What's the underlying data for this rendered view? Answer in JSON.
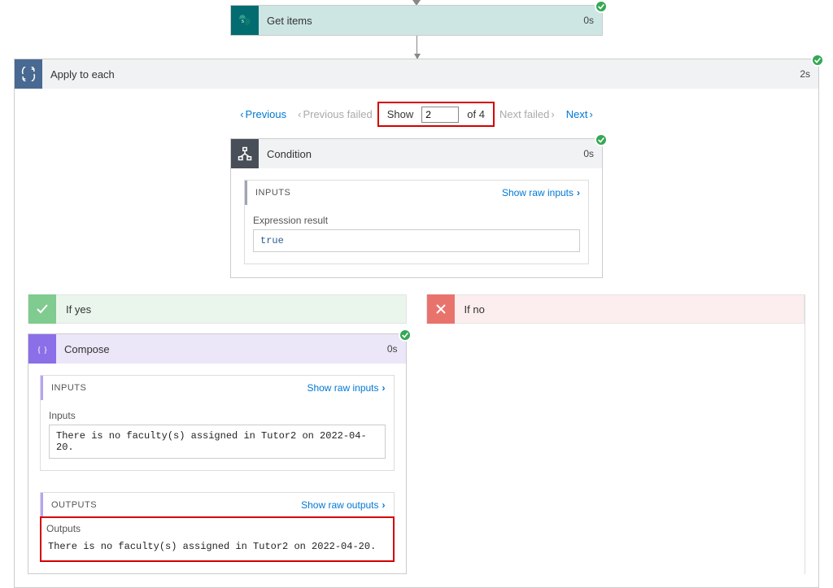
{
  "getItems": {
    "title": "Get items",
    "duration": "0s"
  },
  "applyToEach": {
    "title": "Apply to each",
    "duration": "2s"
  },
  "pager": {
    "previous": "Previous",
    "previousFailed": "Previous failed",
    "showLabel": "Show",
    "current": "2",
    "ofText": "of 4",
    "nextFailed": "Next failed",
    "next": "Next"
  },
  "condition": {
    "title": "Condition",
    "duration": "0s",
    "inputsLabel": "INPUTS",
    "showRawInputs": "Show raw inputs",
    "exprLabel": "Expression result",
    "exprValue": "true"
  },
  "branches": {
    "yes": "If yes",
    "no": "If no"
  },
  "compose": {
    "title": "Compose",
    "duration": "0s",
    "inputsLabel": "INPUTS",
    "showRawInputs": "Show raw inputs",
    "inputsField": "Inputs",
    "inputsValue": "There is no faculty(s) assigned in Tutor2 on 2022-04-20.",
    "outputsLabel": "OUTPUTS",
    "showRawOutputs": "Show raw outputs",
    "outputsField": "Outputs",
    "outputsValue": "There is no faculty(s) assigned in Tutor2 on 2022-04-20."
  }
}
